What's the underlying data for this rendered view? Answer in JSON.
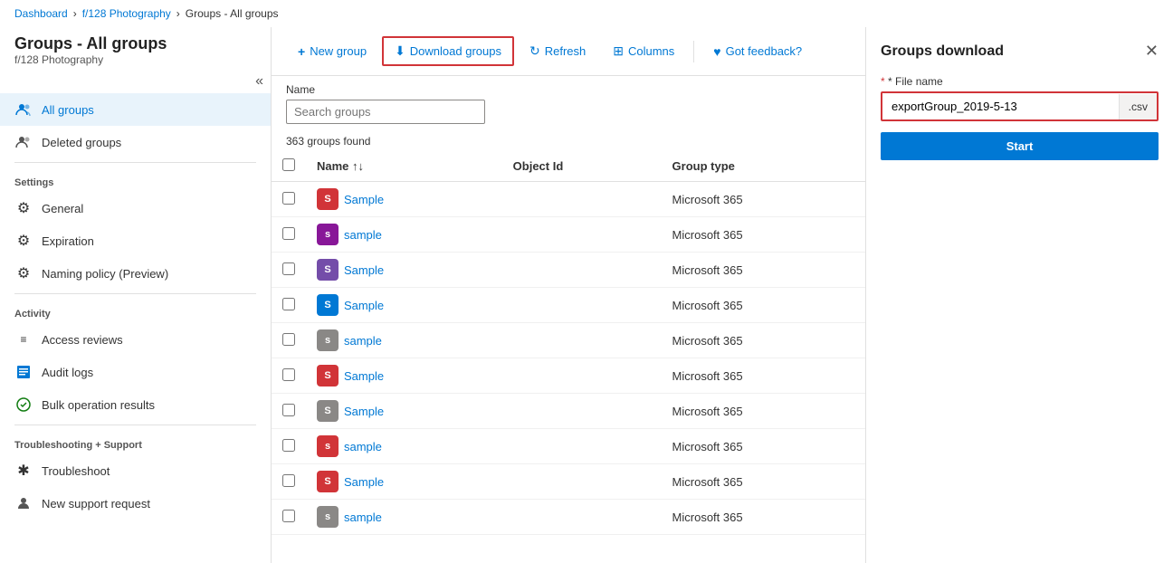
{
  "breadcrumb": {
    "items": [
      "Dashboard",
      "f/128 Photography",
      "Groups - All groups"
    ],
    "links": [
      true,
      true,
      false
    ]
  },
  "sidebar": {
    "title": "Groups - All groups",
    "subtitle": "f/128 Photography",
    "collapseIcon": "«",
    "navItems": [
      {
        "id": "all-groups",
        "label": "All groups",
        "icon": "👥",
        "active": true
      },
      {
        "id": "deleted-groups",
        "label": "Deleted groups",
        "icon": "👥",
        "active": false
      }
    ],
    "sections": [
      {
        "label": "Settings",
        "items": [
          {
            "id": "general",
            "label": "General",
            "icon": "⚙"
          },
          {
            "id": "expiration",
            "label": "Expiration",
            "icon": "⚙"
          },
          {
            "id": "naming-policy",
            "label": "Naming policy (Preview)",
            "icon": "⚙"
          }
        ]
      },
      {
        "label": "Activity",
        "items": [
          {
            "id": "access-reviews",
            "label": "Access reviews",
            "icon": "≡"
          },
          {
            "id": "audit-logs",
            "label": "Audit logs",
            "icon": "📋"
          },
          {
            "id": "bulk-operation",
            "label": "Bulk operation results",
            "icon": "🔧"
          }
        ]
      },
      {
        "label": "Troubleshooting + Support",
        "items": [
          {
            "id": "troubleshoot",
            "label": "Troubleshoot",
            "icon": "✱"
          },
          {
            "id": "new-support",
            "label": "New support request",
            "icon": "👤"
          }
        ]
      }
    ]
  },
  "toolbar": {
    "buttons": [
      {
        "id": "new-group",
        "label": "New group",
        "icon": "+",
        "highlighted": false
      },
      {
        "id": "download-groups",
        "label": "Download groups",
        "icon": "⬇",
        "highlighted": true
      },
      {
        "id": "refresh",
        "label": "Refresh",
        "icon": "↻",
        "highlighted": false
      },
      {
        "id": "columns",
        "label": "Columns",
        "icon": "⊞",
        "highlighted": false
      },
      {
        "id": "feedback",
        "label": "Got feedback?",
        "icon": "♥",
        "highlighted": false
      }
    ]
  },
  "filter": {
    "label": "Name",
    "placeholder": "Search groups"
  },
  "results": {
    "count": "363 groups found"
  },
  "table": {
    "columns": [
      "Name ↑↓",
      "Object Id",
      "Group type"
    ],
    "rows": [
      {
        "name": "Sample",
        "avatarColor": "#d13438",
        "avatarLetter": "S",
        "objectId": "",
        "groupType": "Microsoft 365"
      },
      {
        "name": "sample",
        "avatarColor": "#881798",
        "avatarLetter": "s",
        "objectId": "",
        "groupType": "Microsoft 365"
      },
      {
        "name": "Sample",
        "avatarColor": "#744da9",
        "avatarLetter": "S",
        "objectId": "",
        "groupType": "Microsoft 365"
      },
      {
        "name": "Sample",
        "avatarColor": "#0078d4",
        "avatarLetter": "S",
        "objectId": "",
        "groupType": "Microsoft 365"
      },
      {
        "name": "sample",
        "avatarColor": "#8a8886",
        "avatarLetter": "s",
        "objectId": "",
        "groupType": "Microsoft 365"
      },
      {
        "name": "Sample",
        "avatarColor": "#d13438",
        "avatarLetter": "S",
        "objectId": "",
        "groupType": "Microsoft 365"
      },
      {
        "name": "Sample",
        "avatarColor": "#8a8886",
        "avatarLetter": "S",
        "objectId": "",
        "groupType": "Microsoft 365"
      },
      {
        "name": "sample",
        "avatarColor": "#d13438",
        "avatarLetter": "s",
        "objectId": "",
        "groupType": "Microsoft 365"
      },
      {
        "name": "Sample",
        "avatarColor": "#d13438",
        "avatarLetter": "S",
        "objectId": "",
        "groupType": "Microsoft 365"
      },
      {
        "name": "sample",
        "avatarColor": "#8a8886",
        "avatarLetter": "s",
        "objectId": "",
        "groupType": "Microsoft 365"
      }
    ]
  },
  "rightPanel": {
    "title": "Groups download",
    "fileNameLabel": "* File name",
    "fileNameValue": "exportGroup_2019-5-13",
    "csvSuffix": ".csv",
    "startLabel": "Start"
  }
}
